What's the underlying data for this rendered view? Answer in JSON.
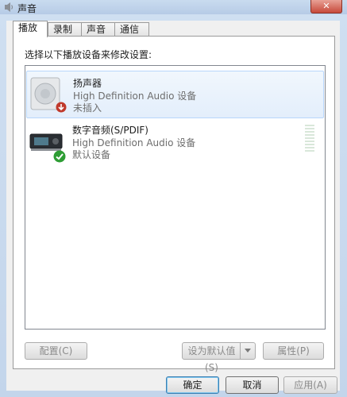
{
  "window": {
    "title": "声音",
    "close_symbol": "✕"
  },
  "tabs": [
    {
      "label": "播放",
      "active": true
    },
    {
      "label": "录制",
      "active": false
    },
    {
      "label": "声音",
      "active": false
    },
    {
      "label": "通信",
      "active": false
    }
  ],
  "instruction": "选择以下播放设备来修改设置:",
  "devices": [
    {
      "name": "扬声器",
      "driver": "High Definition Audio 设备",
      "status": "未插入",
      "icon": "speaker-icon",
      "status_icon": "unplugged-down-arrow-icon",
      "selected": true
    },
    {
      "name": "数字音频(S/PDIF)",
      "driver": "High Definition Audio 设备",
      "status": "默认设备",
      "icon": "spdif-device-icon",
      "status_icon": "default-check-icon",
      "selected": false
    }
  ],
  "buttons": {
    "configure": "配置(C)",
    "set_default": "设为默认值(S)",
    "properties": "属性(P)",
    "ok": "确定",
    "cancel": "取消",
    "apply": "应用(A)"
  },
  "colors": {
    "selection": "#e3eefb",
    "default_check": "#2e9d34",
    "unplugged": "#c0392b"
  }
}
